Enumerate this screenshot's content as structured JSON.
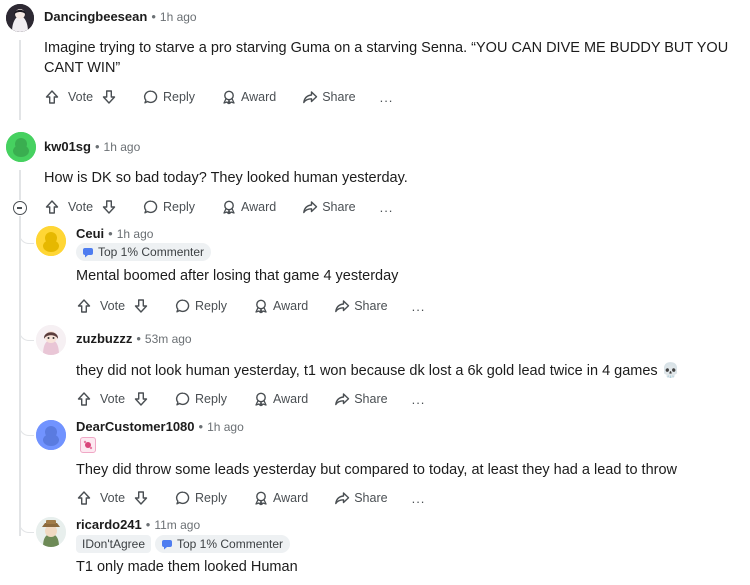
{
  "colors": {
    "text": "#1c1c1c",
    "meta": "#6b7074",
    "action": "#4a4f53",
    "thread": "#e2e4e6",
    "badge_bg": "#eef1f3"
  },
  "actions": {
    "vote": "Vote",
    "reply": "Reply",
    "award": "Award",
    "share": "Share",
    "more": "..."
  },
  "comments": [
    {
      "username": "Dancingbeesean",
      "time": "1h ago",
      "text": "Imagine trying to starve a pro starving Guma on a starving Senna. “YOU CAN DIVE ME BUDDY BUT YOU CANT WIN”"
    },
    {
      "username": "kw01sg",
      "time": "1h ago",
      "text": "How is DK so bad today? They looked human yesterday."
    },
    {
      "username": "Ceui",
      "time": "1h ago",
      "badge": "Top 1% Commenter",
      "text": "Mental boomed after losing that game 4 yesterday"
    },
    {
      "username": "zuzbuzzz",
      "time": "53m ago",
      "text": "they did not look human yesterday, t1 won because dk lost a 6k gold lead twice in 4 games 💀"
    },
    {
      "username": "DearCustomer1080",
      "time": "1h ago",
      "text": "They did throw some leads yesterday but compared to today, at least they had a lead to throw"
    },
    {
      "username": "ricardo241",
      "time": "11m ago",
      "flair": "IDon'tAgree",
      "badge": "Top 1% Commenter",
      "text": "T1 only made them looked Human"
    }
  ]
}
